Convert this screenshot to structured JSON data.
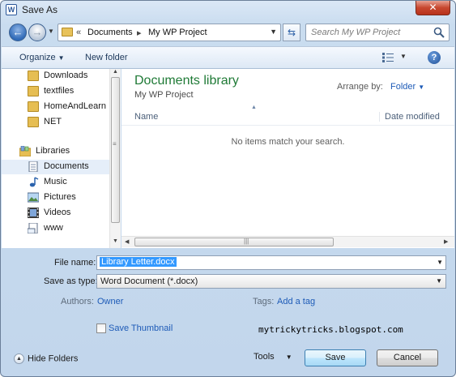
{
  "window": {
    "title": "Save As",
    "close_glyph": "✕"
  },
  "address": {
    "history_arrows": "«",
    "crumbs": [
      "Documents",
      "My WP Project"
    ],
    "separator": "▸"
  },
  "search": {
    "placeholder": "Search My WP Project"
  },
  "toolbar": {
    "organize_label": "Organize",
    "new_folder_label": "New folder",
    "help_glyph": "?"
  },
  "nav": {
    "items": [
      {
        "label": "Downloads",
        "icon": "downloads-folder-icon"
      },
      {
        "label": "textfiles",
        "icon": "folder-icon"
      },
      {
        "label": "HomeAndLearn",
        "icon": "folder-icon"
      },
      {
        "label": "NET",
        "icon": "folder-icon"
      },
      {
        "label": "Libraries",
        "icon": "libraries-icon"
      },
      {
        "label": "Documents",
        "icon": "documents-library-icon",
        "selected": true
      },
      {
        "label": "Music",
        "icon": "music-icon"
      },
      {
        "label": "Pictures",
        "icon": "pictures-icon"
      },
      {
        "label": "Videos",
        "icon": "videos-icon"
      },
      {
        "label": "www",
        "icon": "www-library-icon"
      }
    ]
  },
  "content": {
    "library_title": "Documents library",
    "library_subtitle": "My WP Project",
    "arrange_label": "Arrange by:",
    "arrange_value": "Folder",
    "columns": [
      "Name",
      "Date modified"
    ],
    "empty_message": "No items match your search."
  },
  "form": {
    "file_name_label": "File name:",
    "file_name_value": "Library Letter.docx",
    "save_type_label": "Save as type:",
    "save_type_value": "Word Document (*.docx)",
    "authors_label": "Authors:",
    "authors_value": "Owner",
    "tags_label": "Tags:",
    "tags_value": "Add a tag",
    "thumbnail_label": "Save Thumbnail",
    "thumbnail_checked": false
  },
  "watermark": "mytrickytricks.blogspot.com",
  "footer": {
    "hide_folders_label": "Hide Folders",
    "tools_label": "Tools",
    "save_label": "Save",
    "cancel_label": "Cancel"
  },
  "colors": {
    "library_title": "#1f7a36",
    "link": "#1e5bb7",
    "selection": "#3399ff"
  }
}
